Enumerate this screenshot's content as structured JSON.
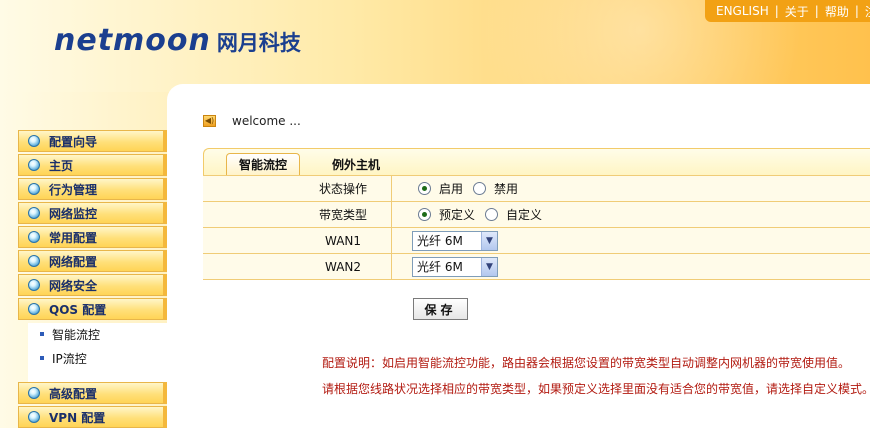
{
  "header": {
    "logo_en": "netmoon",
    "logo_cn": "网月科技",
    "links": [
      "ENGLISH",
      "关于",
      "帮助",
      "注"
    ]
  },
  "sidebar": {
    "items": [
      {
        "label": "配置向导"
      },
      {
        "label": "主页"
      },
      {
        "label": "行为管理"
      },
      {
        "label": "网络监控"
      },
      {
        "label": "常用配置"
      },
      {
        "label": "网络配置"
      },
      {
        "label": "网络安全"
      },
      {
        "label": "QOS 配置"
      },
      {
        "label": "高级配置"
      },
      {
        "label": "VPN 配置"
      }
    ],
    "sub_items": [
      {
        "label": "智能流控"
      },
      {
        "label": "IP流控"
      }
    ]
  },
  "main": {
    "welcome": "welcome ...",
    "tabs": [
      {
        "label": "智能流控",
        "active": true
      },
      {
        "label": "例外主机",
        "active": false
      }
    ],
    "rows": {
      "status": {
        "label": "状态操作",
        "options": [
          "启用",
          "禁用"
        ],
        "selected": "启用"
      },
      "bandwidth": {
        "label": "带宽类型",
        "options": [
          "预定义",
          "自定义"
        ],
        "selected": "预定义"
      },
      "wan1": {
        "label": "WAN1",
        "value": "光纤 6M"
      },
      "wan2": {
        "label": "WAN2",
        "value": "光纤 6M"
      }
    },
    "save_label": "保存",
    "notes": [
      "配置说明：如启用智能流控功能，路由器会根据您设置的带宽类型自动调整内网机器的带宽使用值。",
      "请根据您线路状况选择相应的带宽类型，如果预定义选择里面没有适合您的带宽值，请选择自定义模式。"
    ]
  },
  "colors": {
    "accent": "#f2a114",
    "nav_text": "#1a2f6a",
    "note_text": "#b21a10",
    "brand": "#1b3f8f"
  }
}
